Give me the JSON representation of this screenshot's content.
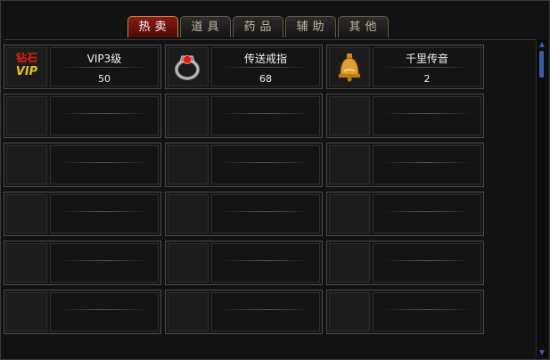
{
  "tabs": [
    "热卖",
    "道具",
    "药品",
    "辅助",
    "其他"
  ],
  "active_tab": 0,
  "items": [
    {
      "name": "VIP3级",
      "count": "50",
      "icon": "diamond-vip-badge",
      "icon_text": "钻石",
      "icon_sub": "VIP"
    },
    {
      "name": "传送戒指",
      "count": "68",
      "icon": "teleport-ring"
    },
    {
      "name": "千里传音",
      "count": "2",
      "icon": "golden-bell"
    }
  ],
  "colors": {
    "active_tab": "#8a1a14",
    "text": "#f0f0f0",
    "scrollbar": "#3c5aa8"
  }
}
